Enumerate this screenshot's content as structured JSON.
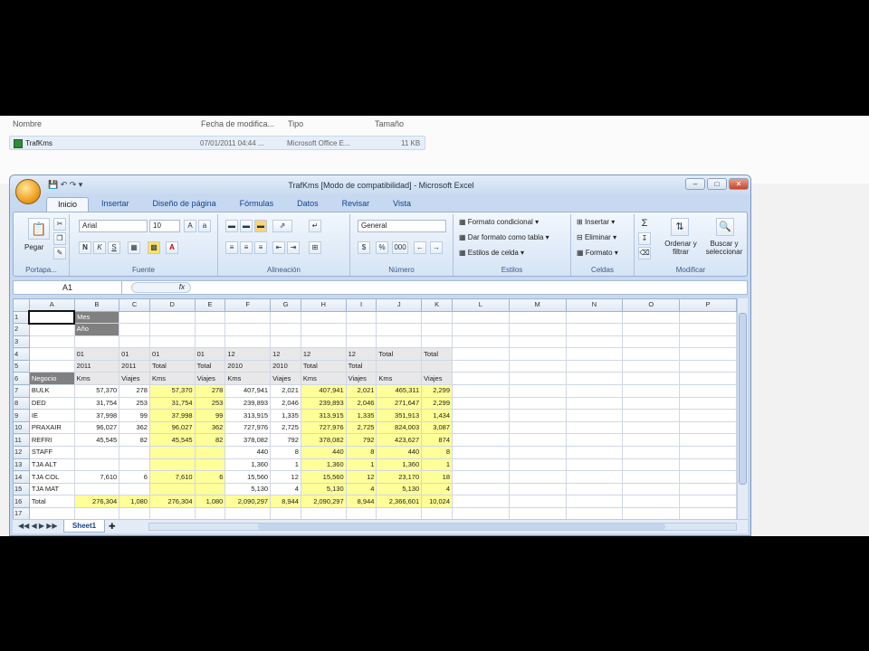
{
  "explorer": {
    "headers": {
      "name": "Nombre",
      "date": "Fecha de modifica...",
      "type": "Tipo",
      "size": "Tamaño"
    },
    "file": {
      "name": "TrafKms",
      "date": "07/01/2011 04:44 ...",
      "type": "Microsoft Office E...",
      "size": "11 KB"
    }
  },
  "window": {
    "title": "TrafKms [Modo de compatibilidad] - Microsoft Excel",
    "tabs": [
      "Inicio",
      "Insertar",
      "Diseño de página",
      "Fórmulas",
      "Datos",
      "Revisar",
      "Vista"
    ],
    "active_tab": "Inicio"
  },
  "ribbon": {
    "paste": "Pegar",
    "clipboard_label": "Portapa...",
    "font_name": "Arial",
    "font_size": "10",
    "font_label": "Fuente",
    "align_label": "Alineación",
    "number_format": "General",
    "number_label": "Número",
    "styles": [
      "Formato condicional",
      "Dar formato como tabla",
      "Estilos de celda"
    ],
    "styles_label": "Estilos",
    "cells": [
      "Insertar",
      "Eliminar",
      "Formato"
    ],
    "cells_label": "Celdas",
    "sort": "Ordenar y filtrar",
    "find": "Buscar y seleccionar",
    "modify_label": "Modificar"
  },
  "formula_bar": {
    "name_box": "A1",
    "fx": "fx",
    "value": ""
  },
  "columns": [
    "",
    "A",
    "B",
    "C",
    "D",
    "E",
    "F",
    "G",
    "H",
    "I",
    "J",
    "K",
    "L",
    "M",
    "N",
    "O",
    "P"
  ],
  "rows": [
    {
      "n": "1",
      "cells": [
        "",
        "Mes",
        "",
        "",
        "",
        "",
        "",
        "",
        "",
        "",
        ""
      ]
    },
    {
      "n": "2",
      "cells": [
        "",
        "Año",
        "",
        "",
        "",
        "",
        "",
        "",
        "",
        "",
        ""
      ]
    },
    {
      "n": "3",
      "cells": [
        "",
        "",
        "",
        "",
        "",
        "",
        "",
        "",
        "",
        "",
        ""
      ]
    },
    {
      "n": "4",
      "cells": [
        "",
        "01",
        "01",
        "01",
        "01",
        "12",
        "12",
        "12",
        "12",
        "Total",
        "Total"
      ]
    },
    {
      "n": "5",
      "cells": [
        "",
        "2011",
        "2011",
        "Total",
        "Total",
        "2010",
        "2010",
        "Total",
        "Total",
        "",
        ""
      ]
    },
    {
      "n": "6",
      "cells": [
        "Negocio",
        "Kms",
        "Viajes",
        "Kms",
        "Viajes",
        "Kms",
        "Viajes",
        "Kms",
        "Viajes",
        "Kms",
        "Viajes"
      ]
    },
    {
      "n": "7",
      "cells": [
        "BULK",
        "57,370",
        "278",
        "57,370",
        "278",
        "407,941",
        "2,021",
        "407,941",
        "2,021",
        "465,311",
        "2,299"
      ]
    },
    {
      "n": "8",
      "cells": [
        "DED",
        "31,754",
        "253",
        "31,754",
        "253",
        "239,893",
        "2,046",
        "239,893",
        "2,046",
        "271,647",
        "2,299"
      ]
    },
    {
      "n": "9",
      "cells": [
        "IE",
        "37,998",
        "99",
        "37,998",
        "99",
        "313,915",
        "1,335",
        "313,915",
        "1,335",
        "351,913",
        "1,434"
      ]
    },
    {
      "n": "10",
      "cells": [
        "PRAXAIR",
        "96,027",
        "362",
        "96,027",
        "362",
        "727,976",
        "2,725",
        "727,976",
        "2,725",
        "824,003",
        "3,087"
      ]
    },
    {
      "n": "11",
      "cells": [
        "REFRI",
        "45,545",
        "82",
        "45,545",
        "82",
        "378,082",
        "792",
        "378,082",
        "792",
        "423,627",
        "874"
      ]
    },
    {
      "n": "12",
      "cells": [
        "STAFF",
        "",
        "",
        "",
        "",
        "440",
        "8",
        "440",
        "8",
        "440",
        "8"
      ]
    },
    {
      "n": "13",
      "cells": [
        "TJA ALT",
        "",
        "",
        "",
        "",
        "1,360",
        "1",
        "1,360",
        "1",
        "1,360",
        "1"
      ]
    },
    {
      "n": "14",
      "cells": [
        "TJA COL",
        "7,610",
        "6",
        "7,610",
        "6",
        "15,560",
        "12",
        "15,560",
        "12",
        "23,170",
        "18"
      ]
    },
    {
      "n": "15",
      "cells": [
        "TJA MAT",
        "",
        "",
        "",
        "",
        "5,130",
        "4",
        "5,130",
        "4",
        "5,130",
        "4"
      ]
    },
    {
      "n": "16",
      "cells": [
        "Total",
        "276,304",
        "1,080",
        "276,304",
        "1,080",
        "2,090,297",
        "8,944",
        "2,090,297",
        "8,944",
        "2,366,601",
        "10,024"
      ]
    },
    {
      "n": "17",
      "cells": [
        "",
        "",
        "",
        "",
        "",
        "",
        "",
        "",
        "",
        "",
        ""
      ]
    }
  ],
  "sheet_tab": "Sheet1"
}
